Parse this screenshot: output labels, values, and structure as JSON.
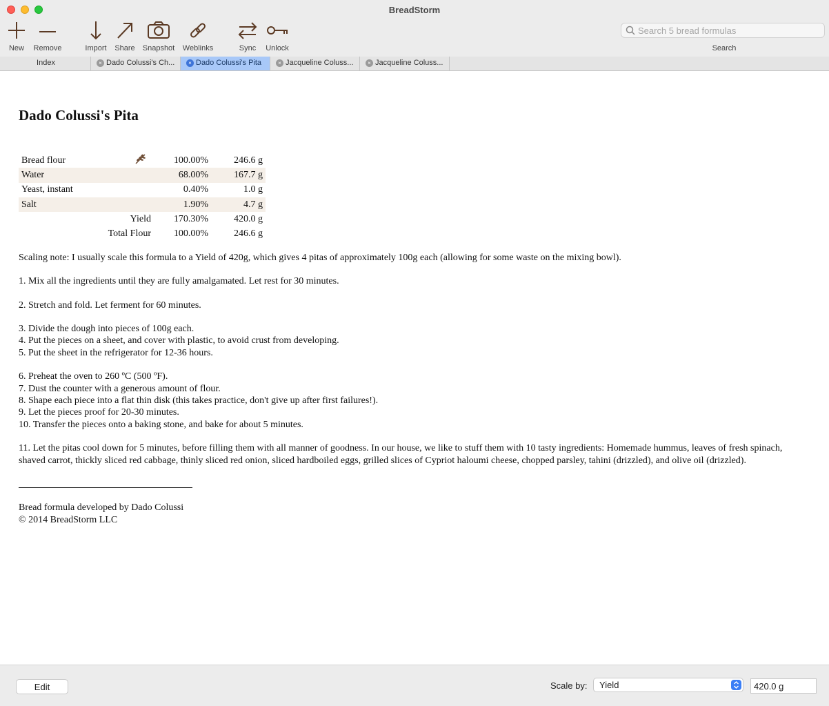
{
  "window": {
    "title": "BreadStorm"
  },
  "toolbar": {
    "new": "New",
    "remove": "Remove",
    "import": "Import",
    "share": "Share",
    "snapshot": "Snapshot",
    "weblinks": "Weblinks",
    "sync": "Sync",
    "unlock": "Unlock",
    "search_placeholder": "Search 5 bread formulas",
    "search_label": "Search"
  },
  "tabs": [
    {
      "label": "Index"
    },
    {
      "label": "Dado Colussi's Ch..."
    },
    {
      "label": "Dado Colussi's Pita",
      "active": true
    },
    {
      "label": "Jacqueline Coluss..."
    },
    {
      "label": "Jacqueline Coluss..."
    }
  ],
  "recipe": {
    "title": "Dado Colussi's Pita",
    "ingredients": [
      {
        "name": "Bread flour",
        "icon": "wheat-icon",
        "percent": "100.00%",
        "weight": "246.6 g"
      },
      {
        "name": "Water",
        "percent": "68.00%",
        "weight": "167.7 g"
      },
      {
        "name": "Yeast, instant",
        "percent": "0.40%",
        "weight": "1.0 g"
      },
      {
        "name": "Salt",
        "percent": "1.90%",
        "weight": "4.7 g"
      }
    ],
    "yield": {
      "label": "Yield",
      "percent": "170.30%",
      "weight": "420.0 g"
    },
    "total_flour": {
      "label": "Total Flour",
      "percent": "100.00%",
      "weight": "246.6 g"
    },
    "scaling_note": "Scaling note: I usually scale this formula to a Yield of 420g, which gives 4 pitas of approximately 100g each (allowing for some waste on the mixing bowl).",
    "steps": {
      "s1": "1. Mix all the ingredients until they are fully amalgamated. Let rest for 30 minutes.",
      "s2": "2. Stretch and fold. Let ferment for 60 minutes.",
      "s3": "3. Divide the dough into pieces of 100g each.",
      "s4": "4. Put the pieces on a sheet, and cover with plastic, to avoid crust from developing.",
      "s5": "5. Put the sheet in the refrigerator for 12-36 hours.",
      "s6": "6. Preheat the oven to 260 ºC (500 ºF).",
      "s7": "7. Dust the counter with a generous amount of flour.",
      "s8": "8. Shape each piece into a flat thin disk (this takes practice, don't give up after first failures!).",
      "s9": "9. Let the pieces proof for 20-30 minutes.",
      "s10": "10. Transfer the pieces onto a baking stone, and bake for about 5 minutes.",
      "s11": "11. Let the pitas cool down for 5 minutes, before filling them with all manner of goodness. In our house, we like to stuff them with 10 tasty ingredients: Homemade hummus, leaves of fresh spinach, shaved carrot, thickly sliced red cabbage, thinly sliced red onion, sliced hardboiled eggs, grilled slices of Cypriot haloumi cheese, chopped parsley, tahini (drizzled), and olive oil (drizzled)."
    },
    "credit": "Bread formula developed by Dado Colussi",
    "copyright": "© 2014 BreadStorm LLC"
  },
  "bottom": {
    "edit": "Edit",
    "scale_by_label": "Scale by:",
    "scale_by_value": "Yield",
    "scale_amount": "420.0 g"
  },
  "colors": {
    "accent": "#3a7ef5",
    "active_tab": "#a8c8f8",
    "row_shade": "#f5efe8",
    "icon_brown": "#6b4a32"
  }
}
